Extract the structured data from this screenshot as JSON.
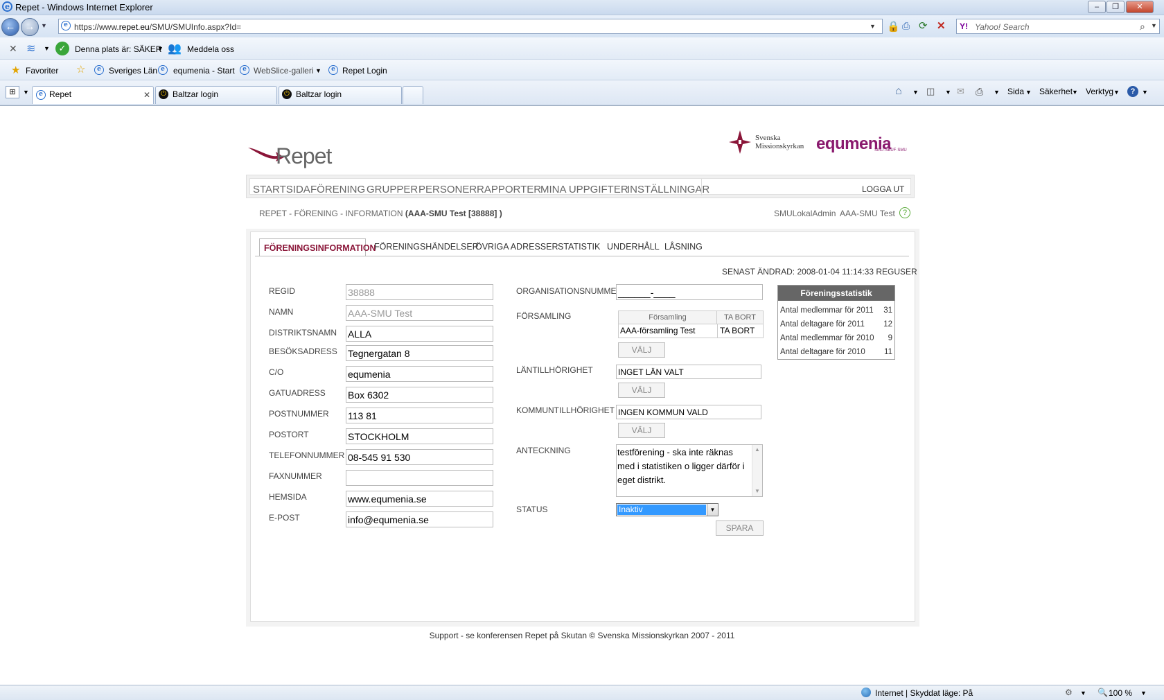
{
  "window": {
    "title": "Repet - Windows Internet Explorer"
  },
  "address": {
    "url_prefix": "https://www.",
    "url_domain": "repet.eu",
    "url_path": "/SMU/SMUInfo.aspx?Id=",
    "search_placeholder": "Yahoo! Search"
  },
  "toolbar": {
    "security_status": "Denna plats är: SÄKER",
    "report": "Meddela oss"
  },
  "favorites": {
    "label": "Favoriter",
    "items": [
      "Sveriges Län",
      "equmenia - Start",
      "WebSlice-galleri",
      "Repet Login"
    ]
  },
  "tabs": [
    {
      "label": "Repet"
    },
    {
      "label": "Baltzar login"
    },
    {
      "label": "Baltzar login"
    }
  ],
  "commandbar": {
    "page": "Sida",
    "safety": "Säkerhet",
    "tools": "Verktyg"
  },
  "brand": {
    "repet": "Repet",
    "svenska": "Svenska",
    "missionskyrkan": "Missionskyrkan",
    "equmenia": "equmenia",
    "equmenia_sub": "SMU·SBUF·SMU"
  },
  "menu": {
    "items": [
      "STARTSIDA",
      "FÖRENING",
      "GRUPPER",
      "PERSONER",
      "RAPPORTER",
      "MINA UPPGIFTER",
      "INSTÄLLNINGAR"
    ],
    "logout": "LOGGA UT"
  },
  "breadcrumb": {
    "path": "REPET - FÖRENING - INFORMATION",
    "entity": "(AAA-SMU Test [38888] )"
  },
  "user": {
    "role": "SMULokalAdmin",
    "org": "AAA-SMU Test",
    "help": "?"
  },
  "subtabs": {
    "active": "FÖRENINGSINFORMATION",
    "items": [
      "FÖRENINGSHÄNDELSER",
      "ÖVRIGA ADRESSER",
      "STATISTIK",
      "UNDERHÅLL",
      "LÅSNING"
    ]
  },
  "last_changed": "SENAST ÄNDRAD: 2008-01-04 11:14:33 REGUSER",
  "form": {
    "regid": {
      "label": "REGID",
      "value": "38888"
    },
    "namn": {
      "label": "NAMN",
      "value": "AAA-SMU Test"
    },
    "distrikt": {
      "label": "DISTRIKTSNAMN",
      "value": "ALLA"
    },
    "besok": {
      "label": "BESÖKSADRESS",
      "value": "Tegnergatan 8"
    },
    "co": {
      "label": "C/O",
      "value": "equmenia"
    },
    "gatu": {
      "label": "GATUADRESS",
      "value": "Box 6302"
    },
    "postnr": {
      "label": "POSTNUMMER",
      "value": "113 81"
    },
    "postort": {
      "label": "POSTORT",
      "value": "STOCKHOLM"
    },
    "telefon": {
      "label": "TELEFONNUMMER",
      "value": "08-545 91 530"
    },
    "fax": {
      "label": "FAXNUMMER",
      "value": ""
    },
    "hemsida": {
      "label": "HEMSIDA",
      "value": "www.equmenia.se"
    },
    "epost": {
      "label": "E-POST",
      "value": "info@equmenia.se"
    },
    "orgnr": {
      "label": "ORGANISATIONSNUMMER",
      "value": "______-____"
    },
    "forsamling": {
      "label": "FÖRSAMLING",
      "col1": "Församling",
      "col2": "TA BORT",
      "row_name": "AAA-församling Test",
      "row_action": "TA BORT",
      "button": "VÄLJ"
    },
    "lan": {
      "label": "LÄNTILLHÖRIGHET",
      "value": "INGET LÄN VALT",
      "button": "VÄLJ"
    },
    "kommun": {
      "label": "KOMMUNTILLHÖRIGHET",
      "value": "INGEN KOMMUN VALD",
      "button": "VÄLJ"
    },
    "anteckning": {
      "label": "ANTECKNING",
      "value": "testförening - ska inte räknas med i statistiken o ligger därför i eget distrikt."
    },
    "status": {
      "label": "STATUS",
      "value": "Inaktiv"
    },
    "save": "SPARA"
  },
  "stats": {
    "title": "Föreningsstatistik",
    "rows": [
      {
        "label": "Antal medlemmar för 2011",
        "value": "31"
      },
      {
        "label": "Antal deltagare för 2011",
        "value": "12"
      },
      {
        "label": "Antal medlemmar för 2010",
        "value": "9"
      },
      {
        "label": "Antal deltagare för 2010",
        "value": "11"
      }
    ]
  },
  "footer": "Support - se konferensen Repet på Skutan © Svenska Missionskyrkan 2007 - 2011",
  "statusbar": {
    "zone": "Internet | Skyddat läge: På",
    "zoom": "100 %"
  }
}
